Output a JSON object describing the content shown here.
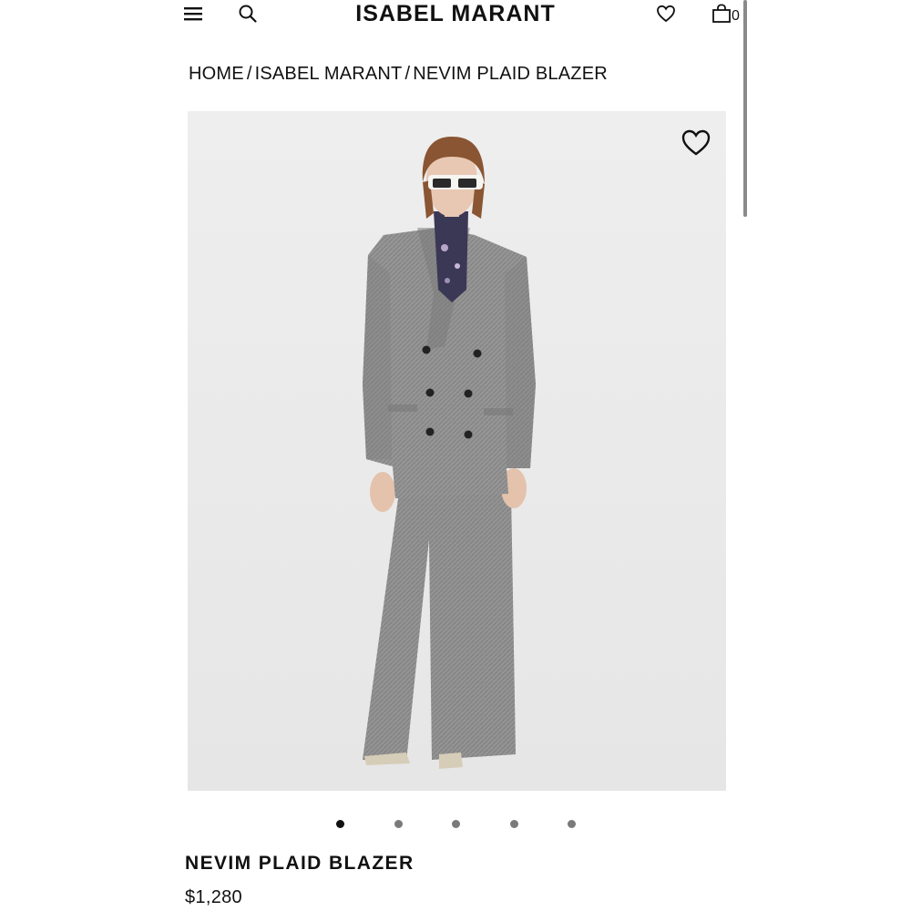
{
  "header": {
    "brand": "ISABEL MARANT",
    "bag_count": "0"
  },
  "breadcrumb": [
    {
      "label": "HOME"
    },
    {
      "label": "ISABEL MARANT"
    },
    {
      "label": "NEVIM PLAID BLAZER"
    }
  ],
  "breadcrumb_separator": "/",
  "gallery": {
    "image_count": 5,
    "active_index": 0
  },
  "product": {
    "name": "NEVIM PLAID BLAZER",
    "price": "$1,280"
  },
  "icons": {
    "menu": "hamburger-menu-icon",
    "search": "search-icon",
    "wishlist": "heart-icon",
    "bag": "shopping-bag-icon",
    "favorite": "heart-outline-icon"
  },
  "colors": {
    "text": "#111111",
    "image_background": "#ececec",
    "dot_inactive": "#7a7a7a",
    "dot_active": "#111111"
  }
}
